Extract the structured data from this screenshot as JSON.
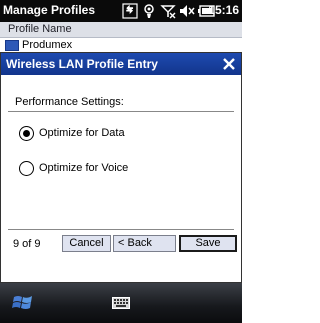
{
  "status_bar": {
    "title": "Manage Profiles",
    "time": "15:16",
    "icons": [
      "network-sync-icon",
      "wifi-signal-icon",
      "no-signal-icon",
      "volume-muted-icon",
      "battery-icon"
    ]
  },
  "background_list": {
    "column_header": "Profile Name",
    "rows": [
      {
        "name": "Produmex"
      }
    ]
  },
  "dialog": {
    "title": "Wireless LAN Profile Entry",
    "section_label": "Performance Settings:",
    "options": [
      {
        "label": "Optimize for Data",
        "selected": true
      },
      {
        "label": "Optimize for Voice",
        "selected": false
      }
    ],
    "page_indicator": "9 of 9",
    "buttons": {
      "cancel": "Cancel",
      "back": "< Back",
      "save": "Save"
    }
  },
  "softkey_bar": {
    "left_icon": "windows-start-icon",
    "center_icon": "keyboard-icon"
  },
  "colors": {
    "status_bar_bg": "#0a0a0a",
    "dialog_title_bg": "#12358c",
    "button_bg": "#dfe3f0",
    "list_header_bg": "#dde0e7"
  }
}
